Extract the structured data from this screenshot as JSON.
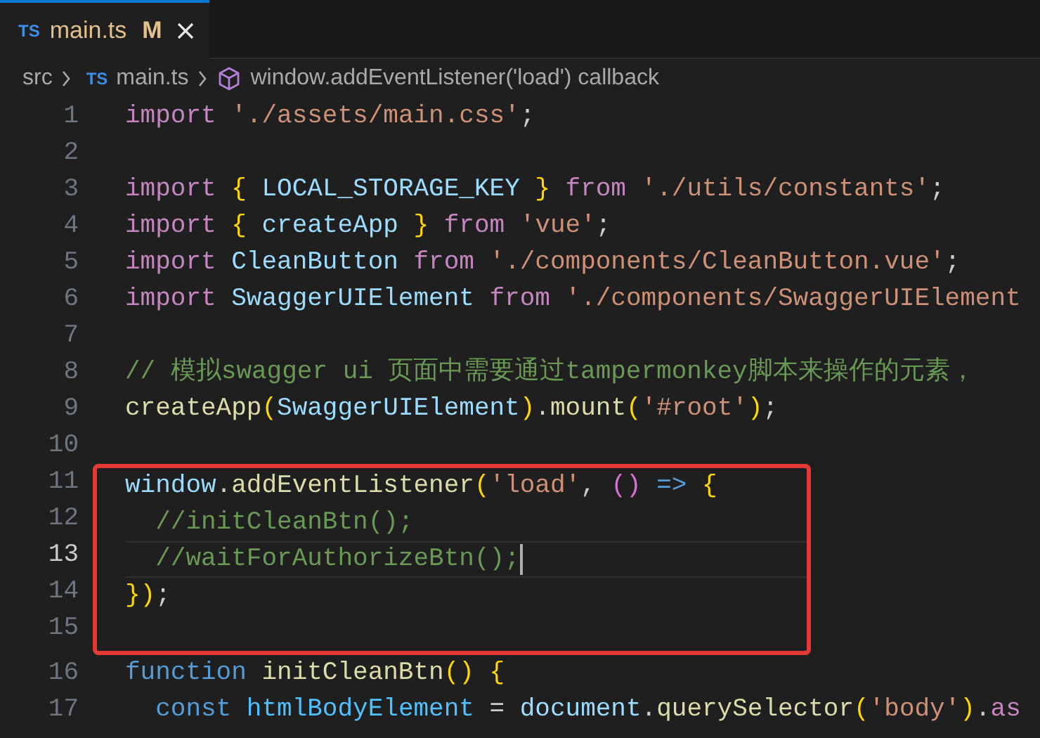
{
  "tabs": [
    {
      "icon_text": "TS",
      "label": "main.ts",
      "badge": "M",
      "selected": true
    }
  ],
  "breadcrumb": {
    "folder": "src",
    "file_icon_text": "TS",
    "file": "main.ts",
    "symbol": "window.addEventListener('load') callback"
  },
  "lines": [
    {
      "number": "1",
      "current": false,
      "annotated": false,
      "tokens": [
        {
          "kind": "keyword",
          "text": "import "
        },
        {
          "kind": "string",
          "text": "'./assets/main.css'"
        },
        {
          "kind": "plain",
          "text": ";"
        }
      ]
    },
    {
      "number": "2",
      "current": false,
      "annotated": false
    },
    {
      "number": "3",
      "current": false,
      "annotated": false,
      "tokens": [
        {
          "kind": "keyword",
          "text": "import "
        },
        {
          "kind": "bracket",
          "text": "{"
        },
        {
          "kind": "variable",
          "text": " LOCAL_STORAGE_KEY "
        },
        {
          "kind": "bracket",
          "text": "} "
        },
        {
          "kind": "keyword",
          "text": "from "
        },
        {
          "kind": "string",
          "text": "'./utils/constants'"
        },
        {
          "kind": "plain",
          "text": ";"
        }
      ]
    },
    {
      "number": "4",
      "current": false,
      "annotated": false,
      "tokens": [
        {
          "kind": "keyword",
          "text": "import "
        },
        {
          "kind": "bracket",
          "text": "{"
        },
        {
          "kind": "variable",
          "text": " createApp "
        },
        {
          "kind": "bracket",
          "text": "} "
        },
        {
          "kind": "keyword",
          "text": "from "
        },
        {
          "kind": "string",
          "text": "'vue'"
        },
        {
          "kind": "plain",
          "text": ";"
        }
      ]
    },
    {
      "number": "5",
      "current": false,
      "annotated": false,
      "tokens": [
        {
          "kind": "keyword",
          "text": "import"
        },
        {
          "kind": "variable",
          "text": " CleanButton "
        },
        {
          "kind": "keyword",
          "text": "from "
        },
        {
          "kind": "string",
          "text": "'./components/CleanButton.vue'"
        },
        {
          "kind": "plain",
          "text": ";"
        }
      ]
    },
    {
      "number": "6",
      "current": false,
      "annotated": false,
      "tokens": [
        {
          "kind": "keyword",
          "text": "import"
        },
        {
          "kind": "variable",
          "text": " SwaggerUIElement "
        },
        {
          "kind": "keyword",
          "text": "from "
        },
        {
          "kind": "string",
          "text": "'./components/SwaggerUIElement"
        }
      ]
    },
    {
      "number": "7",
      "current": false,
      "annotated": false
    },
    {
      "number": "8",
      "current": false,
      "annotated": false,
      "tokens": [
        {
          "kind": "comment",
          "text": "// 模拟swagger ui 页面中需要通过tampermonkey脚本来操作的元素，"
        }
      ]
    },
    {
      "number": "9",
      "current": false,
      "annotated": false,
      "tokens": [
        {
          "kind": "function",
          "text": "createApp"
        },
        {
          "kind": "bracket",
          "text": "("
        },
        {
          "kind": "variable",
          "text": "SwaggerUIElement"
        },
        {
          "kind": "bracket",
          "text": ")"
        },
        {
          "kind": "plain",
          "text": "."
        },
        {
          "kind": "function",
          "text": "mount"
        },
        {
          "kind": "bracket",
          "text": "("
        },
        {
          "kind": "string",
          "text": "'#root'"
        },
        {
          "kind": "bracket",
          "text": ")"
        },
        {
          "kind": "plain",
          "text": ";"
        }
      ]
    },
    {
      "number": "10",
      "current": false,
      "annotated": false
    },
    {
      "number": "11",
      "current": false,
      "annotated": true,
      "tokens": [
        {
          "kind": "variable",
          "text": "window"
        },
        {
          "kind": "plain",
          "text": "."
        },
        {
          "kind": "function",
          "text": "addEventListener"
        },
        {
          "kind": "bracket",
          "text": "("
        },
        {
          "kind": "string",
          "text": "'load'"
        },
        {
          "kind": "plain",
          "text": ", "
        },
        {
          "kind": "bracket2",
          "text": "()"
        },
        {
          "kind": "storage",
          "text": " => "
        },
        {
          "kind": "bracket",
          "text": "{"
        }
      ]
    },
    {
      "number": "12",
      "current": false,
      "annotated": true,
      "tokens": [
        {
          "kind": "comment",
          "text": "  //initCleanBtn();"
        }
      ]
    },
    {
      "number": "13",
      "current": true,
      "annotated": true,
      "tokens": [
        {
          "kind": "comment",
          "text": "  //waitForAuthorizeBtn();"
        }
      ]
    },
    {
      "number": "14",
      "current": false,
      "annotated": true,
      "tokens": [
        {
          "kind": "bracket",
          "text": "})"
        },
        {
          "kind": "plain",
          "text": ";"
        }
      ]
    },
    {
      "number": "15",
      "current": false,
      "annotated": true
    },
    {
      "number": "16",
      "current": false,
      "annotated": false,
      "tokens": [
        {
          "kind": "storage",
          "text": "function "
        },
        {
          "kind": "function",
          "text": "initCleanBtn"
        },
        {
          "kind": "bracket",
          "text": "() {"
        }
      ]
    },
    {
      "number": "17",
      "current": false,
      "annotated": false,
      "tokens": [
        {
          "kind": "storage",
          "text": "  const "
        },
        {
          "kind": "constant",
          "text": "htmlBodyElement"
        },
        {
          "kind": "plain",
          "text": " = "
        },
        {
          "kind": "variable",
          "text": "document"
        },
        {
          "kind": "plain",
          "text": "."
        },
        {
          "kind": "function",
          "text": "querySelector"
        },
        {
          "kind": "bracket",
          "text": "("
        },
        {
          "kind": "string",
          "text": "'body'"
        },
        {
          "kind": "bracket",
          "text": ")"
        },
        {
          "kind": "plain",
          "text": "."
        },
        {
          "kind": "keyword",
          "text": "as"
        }
      ]
    }
  ]
}
